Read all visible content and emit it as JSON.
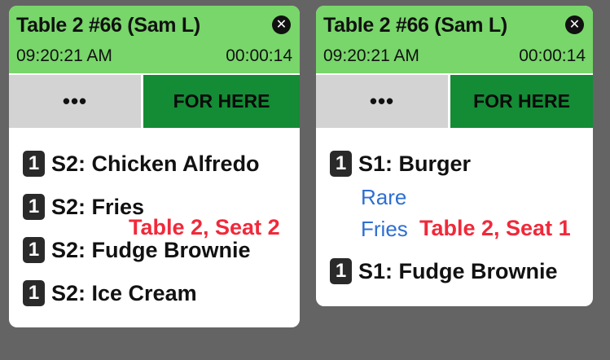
{
  "tickets": [
    {
      "title": "Table 2 #66  (Sam L)",
      "time": "09:20:21 AM",
      "elapsed": "00:00:14",
      "close_icon": "close-icon",
      "more_label": "•••",
      "order_type": "FOR HERE",
      "seat_note": "Table 2, Seat 2",
      "items": [
        {
          "qty": "1",
          "name": "S2: Chicken Alfredo"
        },
        {
          "qty": "1",
          "name": "S2: Fries"
        },
        {
          "qty": "1",
          "name": "S2: Fudge Brownie"
        },
        {
          "qty": "1",
          "name": "S2: Ice Cream"
        }
      ]
    },
    {
      "title": "Table 2 #66  (Sam L)",
      "time": "09:20:21 AM",
      "elapsed": "00:00:14",
      "close_icon": "close-icon",
      "more_label": "•••",
      "order_type": "FOR HERE",
      "seat_note": "Table 2, Seat 1",
      "items": [
        {
          "qty": "1",
          "name": "S1: Burger",
          "modifiers": [
            "Rare",
            "Fries"
          ]
        },
        {
          "qty": "1",
          "name": "S1: Fudge Brownie"
        }
      ]
    }
  ],
  "colors": {
    "background": "#646464",
    "header_green": "#78d66a",
    "for_here_green": "#148b35",
    "more_gray": "#d3d3d3",
    "modifier_blue": "#2e6fd1",
    "seat_note_red": "#f0293a"
  }
}
